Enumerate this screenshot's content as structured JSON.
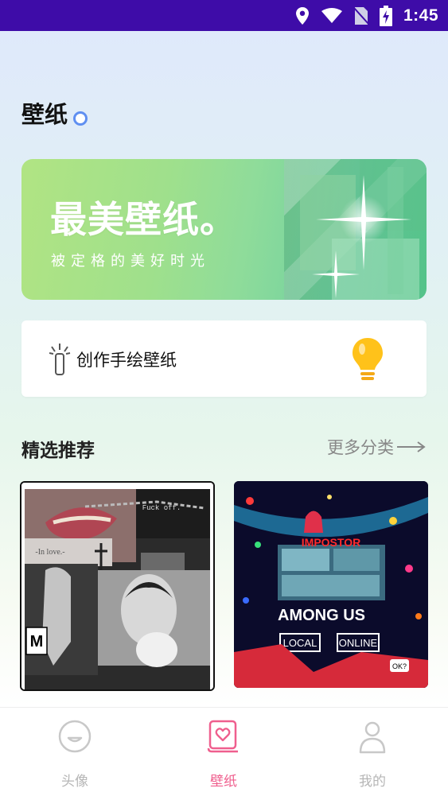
{
  "status_bar": {
    "time": "1:45"
  },
  "header": {
    "title": "壁纸"
  },
  "banner": {
    "title": "最美壁纸。",
    "subtitle": "被定格的美好时光"
  },
  "draw_card": {
    "label": "创作手绘壁纸"
  },
  "featured": {
    "title": "精选推荐",
    "more_label": "更多分类"
  },
  "thumbnails": [
    {
      "caption_1": "Fuck off.",
      "caption_2": "-In love.-"
    },
    {
      "caption_1": "IMPOSTOR",
      "caption_2": "AMONG US",
      "caption_3": "LOCAL",
      "caption_4": "ONLINE",
      "caption_5": "OK?"
    }
  ],
  "tab_bar": {
    "tabs": [
      {
        "label": "头像",
        "icon": "face-icon",
        "active": false
      },
      {
        "label": "壁纸",
        "icon": "wallpaper-icon",
        "active": true
      },
      {
        "label": "我的",
        "icon": "person-icon",
        "active": false
      }
    ]
  },
  "colors": {
    "status_bar": "#3e0ca8",
    "accent": "#ef5f8e",
    "inactive": "#b6b6b6",
    "title_dot": "#5f8ff1",
    "lightbulb": "#ffc21a"
  }
}
